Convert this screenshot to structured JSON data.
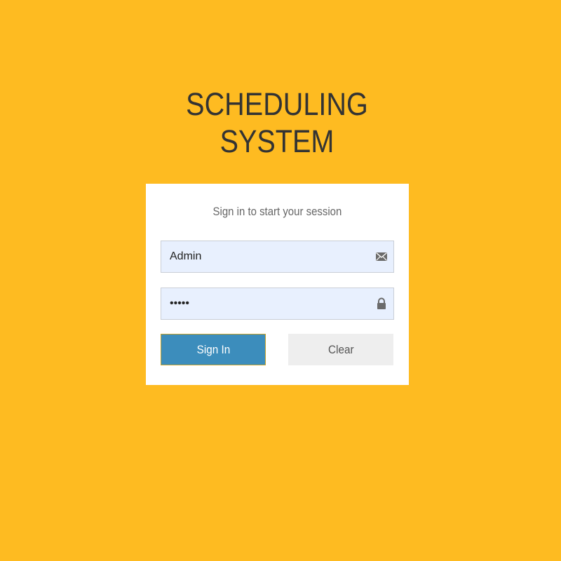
{
  "app": {
    "title_line1": "SCHEDULING",
    "title_line2": "SYSTEM"
  },
  "login": {
    "subtitle": "Sign in to start your session",
    "username_value": "Admin",
    "password_value": "•••••",
    "signin_label": "Sign In",
    "clear_label": "Clear"
  },
  "icons": {
    "username": "envelope-icon",
    "password": "lock-icon"
  },
  "colors": {
    "background": "#FEBB21",
    "primary_button": "#3C8DBC",
    "secondary_button": "#EEEEEE",
    "input_background": "#E8F0FE"
  }
}
